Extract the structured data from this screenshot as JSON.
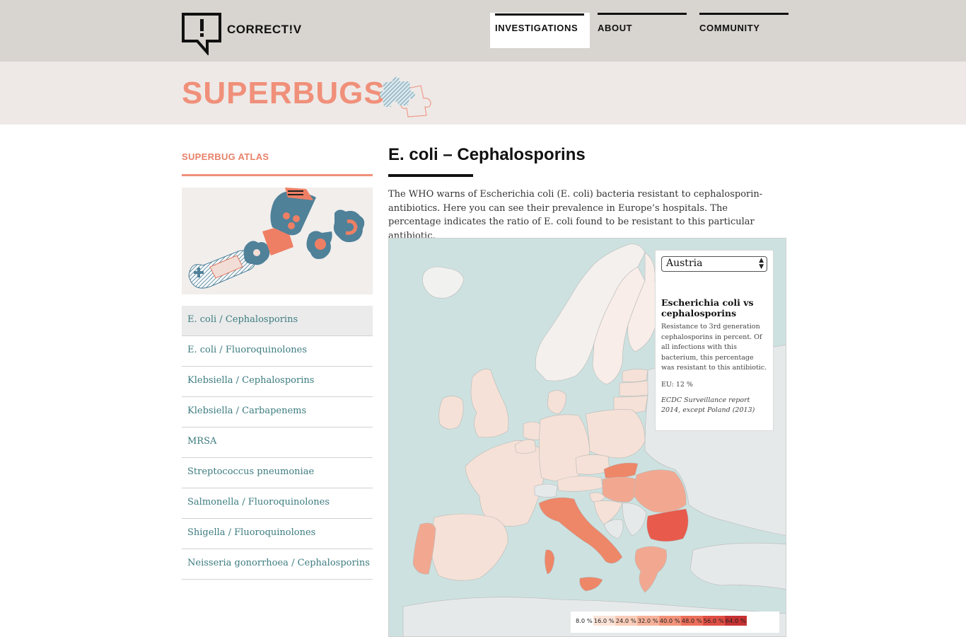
{
  "header": {
    "logo_text": "CORRECT!V",
    "nav": [
      {
        "label": "INVESTIGATIONS"
      },
      {
        "label": "ABOUT"
      },
      {
        "label": "COMMUNITY"
      }
    ]
  },
  "banner": {
    "title": "SUPERBUGS"
  },
  "sidebar": {
    "heading": "SUPERBUG ATLAS",
    "items": [
      {
        "label": "E. coli / Cephalosporins"
      },
      {
        "label": "E. coli / Fluoroquinolones"
      },
      {
        "label": "Klebsiella / Cephalosporins"
      },
      {
        "label": "Klebsiella / Carbapenems"
      },
      {
        "label": "MRSA"
      },
      {
        "label": "Streptococcus pneumoniae"
      },
      {
        "label": "Salmonella / Fluoroquinolones"
      },
      {
        "label": "Shigella / Fluoroquinolones"
      },
      {
        "label": "Neisseria gonorrhoea / Cephalosporins"
      }
    ],
    "active_index": 0
  },
  "main": {
    "title": "E. coli – Cephalosporins",
    "intro": "The WHO warns of Escherichia coli (E. coli) bacteria resistant to cephalosporin-antibiotics. Here you can see their prevalence in Europe’s hospitals. The percentage indicates the ratio of E. coli found to be resistant to this particular antibiotic."
  },
  "map": {
    "selected_country": "Austria",
    "info_title": "Escherichia coli vs cephalosporins",
    "info_desc": "Resistance to 3rd generation cephalosporins in percent. Of all infections with this bacterium, this percentage was resistant to this antibiotic.",
    "eu_value": "EU: 12 %",
    "source": "ECDC Surveillance report 2014, except Poland (2013)",
    "legend": [
      {
        "label": "8.0 %",
        "color": "#ffffff"
      },
      {
        "label": "16.0 %",
        "color": "#fbe3d8"
      },
      {
        "label": "24.0 %",
        "color": "#f9cdb9"
      },
      {
        "label": "32.0 %",
        "color": "#f6b29a"
      },
      {
        "label": "40.0 %",
        "color": "#f2937a"
      },
      {
        "label": "48.0 %",
        "color": "#ec6f5b"
      },
      {
        "label": "56.0 %",
        "color": "#e04f45"
      },
      {
        "label": "64.0 %",
        "color": "#c63233"
      }
    ],
    "colors": {
      "sea": "#cde2e0",
      "no_data": "#e6e9ea",
      "low": "#f5e1d7",
      "lighter": "#f8ede8",
      "medium": "#f2a890",
      "high": "#ee8668",
      "highest": "#e85a4c"
    }
  }
}
